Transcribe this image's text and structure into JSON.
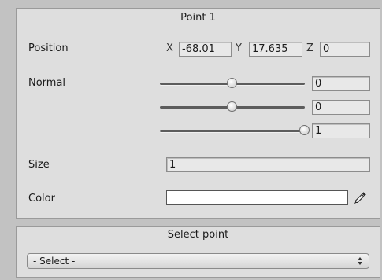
{
  "point_panel": {
    "title": "Point 1",
    "position": {
      "label": "Position",
      "x_label": "X",
      "x_value": "-68.01",
      "y_label": "Y",
      "y_value": "17.635",
      "z_label": "Z",
      "z_value": "0"
    },
    "normal": {
      "label": "Normal",
      "sliders": [
        {
          "value": "0",
          "level": 0.5
        },
        {
          "value": "0",
          "level": 0.5
        },
        {
          "value": "1",
          "level": 1.0
        }
      ]
    },
    "size": {
      "label": "Size",
      "value": "1"
    },
    "color": {
      "label": "Color",
      "value": "#ffffff",
      "picker_icon": "eyedropper-icon"
    }
  },
  "select_panel": {
    "title": "Select point",
    "dropdown_value": "- Select -",
    "dropdown_icon": "updown-arrows-icon"
  }
}
